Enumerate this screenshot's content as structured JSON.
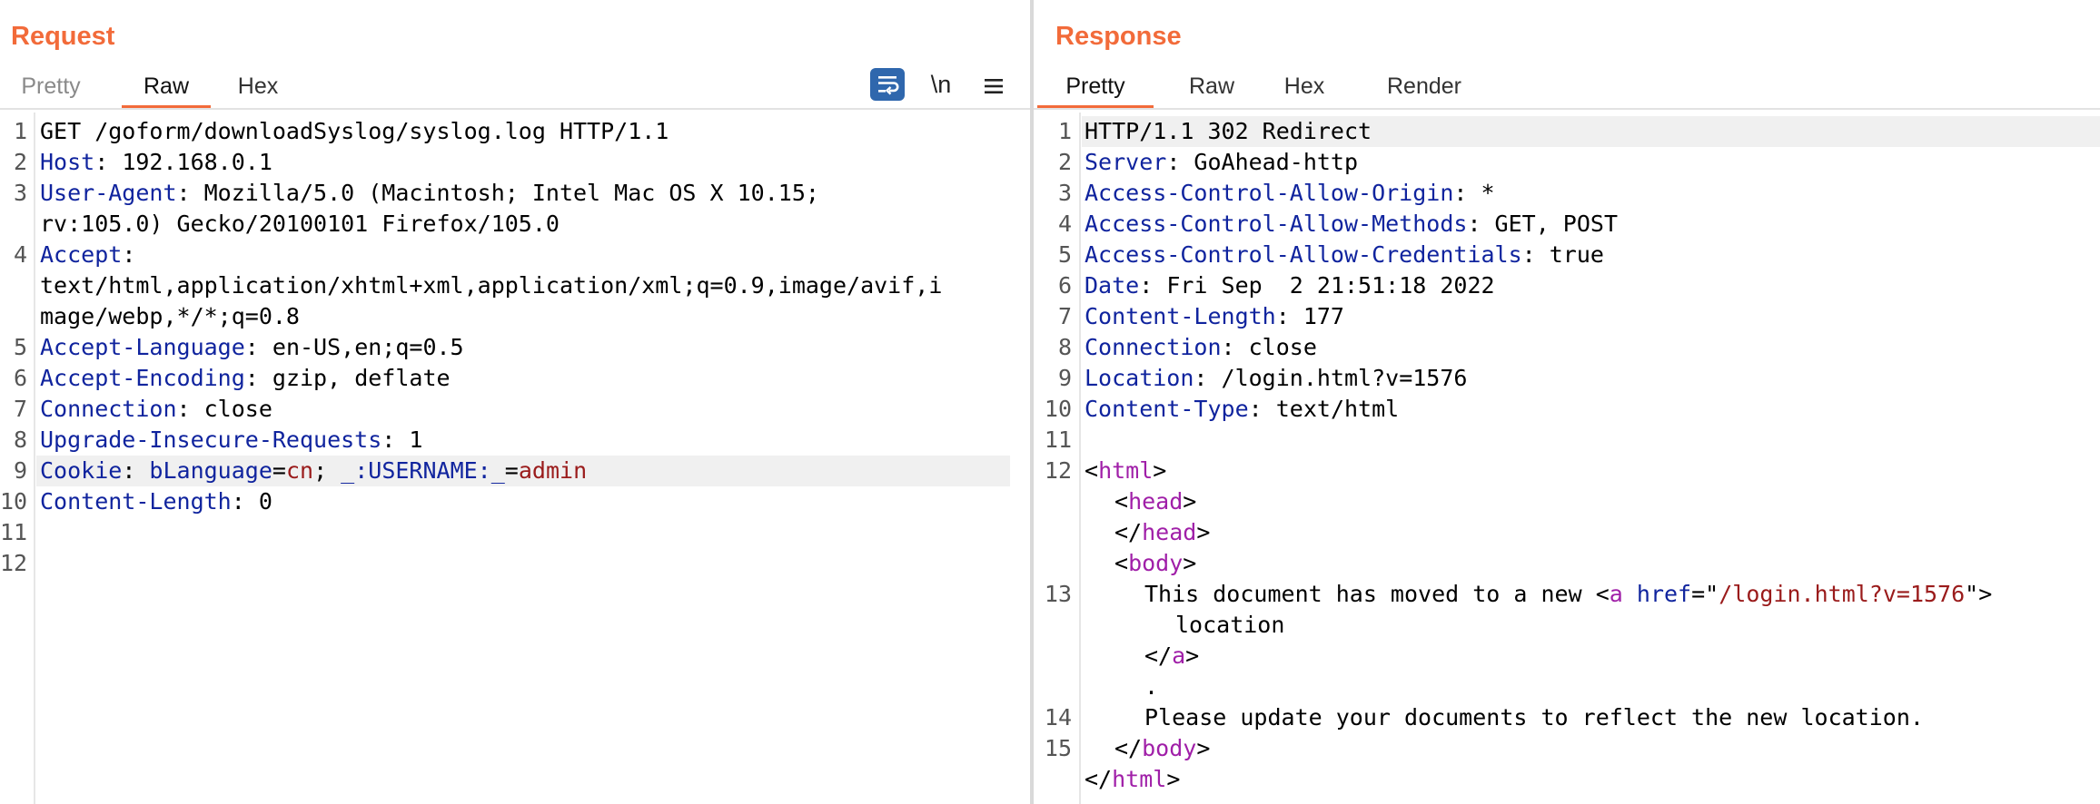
{
  "request": {
    "title": "Request",
    "tabs": [
      "Pretty",
      "Raw",
      "Hex"
    ],
    "active_tab": "Raw",
    "tools": {
      "wrap_icon": "wrap-lines-icon",
      "newline_label": "\\n",
      "menu_icon": "hamburger-menu-icon"
    },
    "line_numbers": [
      "1",
      "2",
      "3",
      "4",
      "5",
      "6",
      "7",
      "8",
      "9",
      "10",
      "11",
      "12"
    ],
    "lines": {
      "l1": "GET /goform/downloadSyslog/syslog.log HTTP/1.1",
      "host_key": "Host",
      "host_sep": ": ",
      "host_val": "192.168.0.1",
      "ua_key": "User-Agent",
      "ua_sep": ": ",
      "ua_val1": "Mozilla/5.0 (Macintosh; Intel Mac OS X 10.15;",
      "ua_val2": "rv:105.0) Gecko/20100101 Firefox/105.0",
      "accept_key": "Accept",
      "accept_sep": ":",
      "accept_val1": "text/html,application/xhtml+xml,application/xml;q=0.9,image/avif,i",
      "accept_val2": "mage/webp,*/*;q=0.8",
      "lang_key": "Accept-Language",
      "lang_sep": ": ",
      "lang_val": "en-US,en;q=0.5",
      "enc_key": "Accept-Encoding",
      "enc_sep": ": ",
      "enc_val": "gzip, deflate",
      "conn_key": "Connection",
      "conn_sep": ": ",
      "conn_val": "close",
      "uir_key": "Upgrade-Insecure-Requests",
      "uir_sep": ": ",
      "uir_val": "1",
      "cookie_key": "Cookie",
      "cookie_sep": ": ",
      "cookie_n1": "bLanguage",
      "cookie_eq1": "=",
      "cookie_v1": "cn",
      "cookie_semi": "; ",
      "cookie_n2": "_:USERNAME:_",
      "cookie_eq2": "=",
      "cookie_v2": "admin",
      "cl_key": "Content-Length",
      "cl_sep": ": ",
      "cl_val": "0"
    }
  },
  "response": {
    "title": "Response",
    "tabs": [
      "Pretty",
      "Raw",
      "Hex",
      "Render"
    ],
    "active_tab": "Pretty",
    "line_numbers": [
      "1",
      "2",
      "3",
      "4",
      "5",
      "6",
      "7",
      "8",
      "9",
      "10",
      "11",
      "12",
      "13",
      "14",
      "15"
    ],
    "lines": {
      "l1": "HTTP/1.1 302 Redirect",
      "server_key": "Server",
      "server_sep": ": ",
      "server_val": "GoAhead-http",
      "acao_key": "Access-Control-Allow-Origin",
      "acao_sep": ": ",
      "acao_val": "*",
      "acam_key": "Access-Control-Allow-Methods",
      "acam_sep": ": ",
      "acam_val": "GET, POST",
      "acac_key": "Access-Control-Allow-Credentials",
      "acac_sep": ": ",
      "acac_val": "true",
      "date_key": "Date",
      "date_sep": ": ",
      "date_val": "Fri Sep  2 21:51:18 2022",
      "cl_key": "Content-Length",
      "cl_sep": ": ",
      "cl_val": "177",
      "conn_key": "Connection",
      "conn_sep": ": ",
      "conn_val": "close",
      "loc_key": "Location",
      "loc_sep": ": ",
      "loc_val": "/login.html?v=1576",
      "ct_key": "Content-Type",
      "ct_sep": ": ",
      "ct_val": "text/html",
      "lt": "<",
      "gt": ">",
      "lts": "</",
      "html_tag": "html",
      "head_tag": "head",
      "body_tag": "body",
      "a_tag": "a",
      "body_text": "This document has moved to a new ",
      "href_attr": "href",
      "attr_eq": "=",
      "quote": "\"",
      "href_val": "/login.html?v=1576",
      "a_text": "location",
      "dot": ".",
      "update_text": "Please update your documents to reflect the new location."
    }
  },
  "colors": {
    "accent": "#f26b3a",
    "header_key": "#10249e",
    "value_red": "#9a1b1b",
    "tag_purple": "#a01fa8",
    "wrap_button": "#2f67ad"
  }
}
